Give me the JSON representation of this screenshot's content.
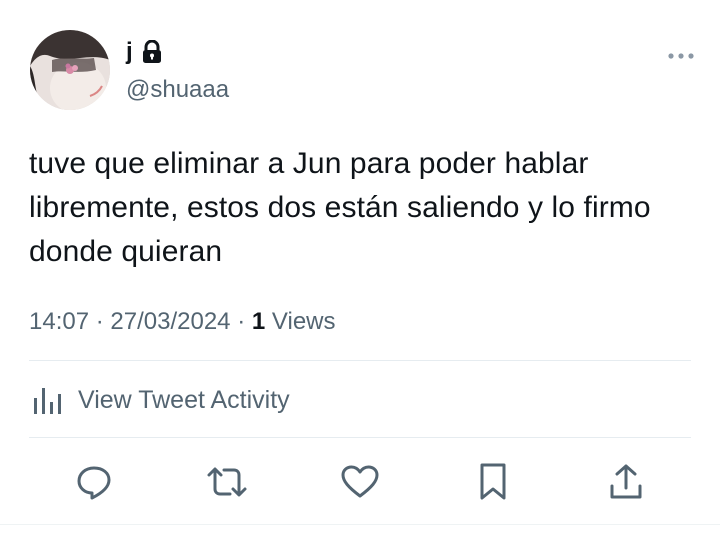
{
  "author": {
    "display_name": "j",
    "handle": "@shuaaa",
    "protected": true
  },
  "tweet": {
    "text": "tuve que eliminar a Jun para poder hablar libremente, estos dos están saliendo y lo firmo donde quieran",
    "time": "14:07",
    "date": "27/03/2024",
    "separator": "·",
    "views_count": "1",
    "views_label": "Views"
  },
  "activity": {
    "label": "View Tweet Activity"
  },
  "actions": [
    {
      "name": "reply",
      "icon": "reply-icon"
    },
    {
      "name": "retweet",
      "icon": "retweet-icon"
    },
    {
      "name": "like",
      "icon": "heart-icon"
    },
    {
      "name": "bookmark",
      "icon": "bookmark-icon"
    },
    {
      "name": "share",
      "icon": "share-icon"
    }
  ],
  "colors": {
    "text_primary": "#0f1419",
    "text_secondary": "#536471",
    "divider": "#e6ecf0"
  }
}
